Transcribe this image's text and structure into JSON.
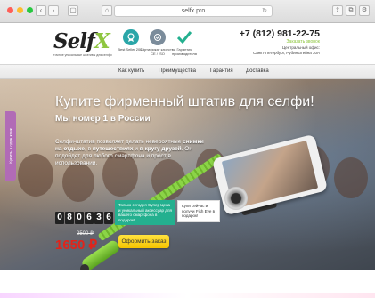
{
  "browser": {
    "url": "selfx.pro",
    "reload_glyph": "↻",
    "back_glyph": "‹",
    "forward_glyph": "›",
    "tabs_glyph": "▢",
    "home_glyph": "⌂",
    "share_glyph": "⇪",
    "newtab_glyph": "⧉",
    "settings_glyph": "⚙"
  },
  "header": {
    "logo_main": "Self",
    "logo_x": "X",
    "logo_sub": "точные уникальные штативы для селфи",
    "badges": [
      {
        "icon": "medal-icon",
        "color": "#2aa6a8",
        "text": "Best Seller 2014"
      },
      {
        "icon": "certificate-icon",
        "color": "#7b8c9b",
        "text": "Сертификат качества CE / ISO"
      },
      {
        "icon": "checkmark-icon",
        "color": "#24b08f",
        "text": "Гарантия производителя"
      }
    ],
    "phone": "+7 (812) 981-22-75",
    "callback": "Заказать звонок",
    "office_line1": "Центральный офис:",
    "office_line2": "Санкт-Петербург, Рубинштейна 30А"
  },
  "nav": {
    "items": [
      "Как купить",
      "Преимущества",
      "Гарантия",
      "Доставка"
    ]
  },
  "hero": {
    "title": "Купите фирменный штатив для селфи!",
    "subtitle": "Мы номер 1 в России",
    "desc_part1": "Селфи-штатив позволяет делать невероятные ",
    "desc_bold1": "снимки на отдыхе",
    "desc_part2": ", в ",
    "desc_bold2": "путешествиях",
    "desc_part3": " и ",
    "desc_bold3": "в кругу друзей",
    "desc_part4": ". Он подойдет для любого смартфона и прост в использовании.",
    "side_tab": "Купить в один клик"
  },
  "offer": {
    "bubble_green": "Только сегодня Супер Цена и уникальный аксессуар для вашего смартфона в подарок!",
    "bubble_white": "Купи сейчас и получи Fish Eye в подарок!",
    "countdown": [
      "0",
      "8",
      "0",
      "6",
      "3",
      "6"
    ],
    "old_price": "2500 ₽",
    "new_price": "1650 ₽",
    "order_button": "Оформить заказ"
  },
  "colors": {
    "brand_green": "#8ec63f",
    "accent_red": "#e2231a",
    "button_yellow": "#f5c400",
    "teal": "#24b08f",
    "side_tab": "#b16bb6"
  }
}
